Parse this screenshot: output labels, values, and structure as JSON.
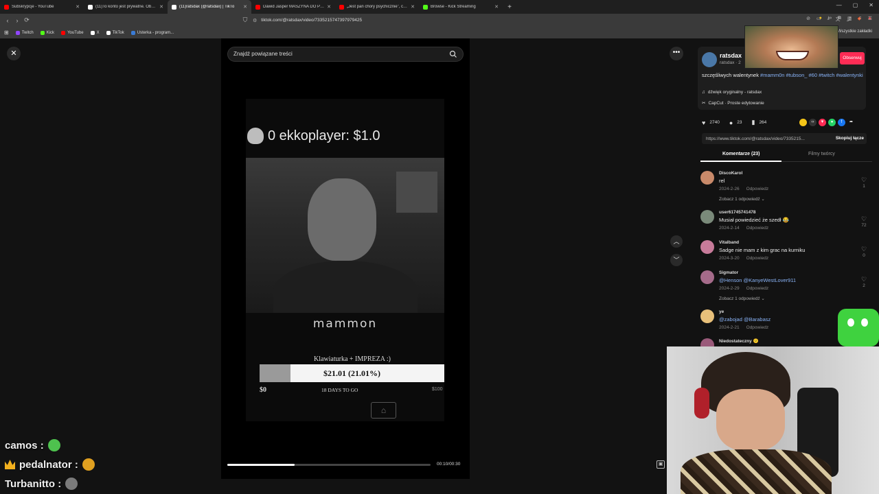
{
  "browser": {
    "tabs": [
      {
        "title": "Subskrypcje - YouTube",
        "icon": "youtube-icon",
        "color": "#ff0000",
        "active": false
      },
      {
        "title": "(11)To konto jest prywatne. Obserwu",
        "icon": "tiktok-icon",
        "color": "#ffffff",
        "active": false
      },
      {
        "title": "(11)ratsdax (@ratsdax) | TikTo",
        "icon": "tiktok-icon",
        "color": "#ffffff",
        "active": true
      },
      {
        "title": "Dawid Jasper MASZYNA DO PIERO",
        "icon": "youtube-icon",
        "color": "#ff0000",
        "active": false
      },
      {
        "title": "„Jest pan chory psychicznie”, czyli o",
        "icon": "youtube-icon",
        "color": "#ff0000",
        "active": false
      },
      {
        "title": "Browse - Kick Streaming",
        "icon": "kick-icon",
        "color": "#53fc18",
        "active": false
      }
    ],
    "url": "tiktok.com/@ratsdax/video/7335215747397979425",
    "bookmarks": [
      {
        "label": "Twitch",
        "color": "#9146ff"
      },
      {
        "label": "Kick",
        "color": "#53fc18"
      },
      {
        "label": "YouTube",
        "color": "#ff0000"
      },
      {
        "label": "X",
        "color": "#ffffff"
      },
      {
        "label": "TikTok",
        "color": "#ffffff"
      },
      {
        "label": "Usterka - program...",
        "color": "#3a7bd5"
      }
    ],
    "all_bookmarks": "Wszystkie zakładki"
  },
  "search": {
    "placeholder": "Znajdź powiązane treści"
  },
  "video": {
    "ekko_text": "0 ekkoplayer: $1.0",
    "mammon": "mammon",
    "goal_title": "Klawiaturka + IMPREZA :)",
    "goal_amount": "$21.01 (21.01%)",
    "goal_fraction": 0.2101,
    "goal_min": "$0",
    "goal_days": "18 DAYS TO GO",
    "goal_max": "$100",
    "progress_fraction": 0.33,
    "time": "00:10/00:30"
  },
  "panel": {
    "author": "ratsdax",
    "author_sub": "ratsdax · 2",
    "follow": "Obserwuj",
    "caption": "szczęśliwych walentynek",
    "hashtags": "#mamm0n #tubson_ #60 #twitch #walentynki",
    "sound": "dźwięk oryginalny - ratsdax",
    "capcut": "CapCut · Proste edytowanie",
    "likes": "2740",
    "comments": "23",
    "saves": "264",
    "link": "https://www.tiktok.com/@ratsdax/video/7335215...",
    "copy": "Skopiuj łącze",
    "tab_comments": "Komentarze (23)",
    "tab_creator": "Filmy twórcy"
  },
  "comments": [
    {
      "user": "DiscoKarol",
      "text": "rel",
      "date": "2024-2-26",
      "reply": "Odpowiedz",
      "more": "Zobacz 1 odpowiedź ⌄",
      "likes": "1",
      "color": "#c98a6a"
    },
    {
      "user": "user6174574147​8",
      "text": "Musiał powiedzieć że szedł 😂",
      "date": "2024-2-14",
      "reply": "Odpowiedz",
      "more": "",
      "likes": "72",
      "color": "#7a8a7a"
    },
    {
      "user": "Vitalband",
      "text": "Sadge nie mam z kim grac na kurniku",
      "date": "2024-3-20",
      "reply": "Odpowiedz",
      "more": "",
      "likes": "0",
      "color": "#c77b9a"
    },
    {
      "user": "Sigmator",
      "text": "@Henson @KanyeWestLover911",
      "date": "2024-2-29",
      "reply": "Odpowiedz",
      "more": "Zobacz 1 odpowiedź ⌄",
      "likes": "2",
      "color": "#a56b8a"
    },
    {
      "user": "ye",
      "text": "@zabojad @Barabasz",
      "date": "2024-2-21",
      "reply": "Odpowiedz",
      "more": "",
      "likes": "",
      "color": "#e8c07a"
    },
    {
      "user": "Niedostateczny 😕",
      "text": "",
      "date": "",
      "reply": "",
      "more": "",
      "likes": "",
      "color": "#9a5a7a"
    }
  ],
  "chat": [
    {
      "user": "camos :",
      "emote_color": "#4ec24e",
      "crown": false
    },
    {
      "user": "pedalnator :",
      "emote_color": "#e0a020",
      "crown": true
    },
    {
      "user": "Turbanitto :",
      "emote_color": "#7a7a7a",
      "crown": false
    }
  ]
}
